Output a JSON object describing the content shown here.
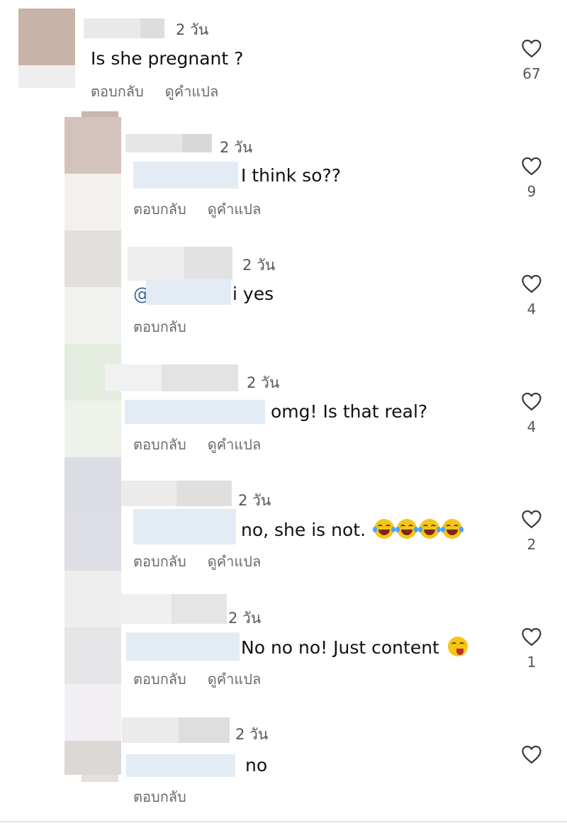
{
  "labels": {
    "reply": "ตอบกลับ",
    "translate": "ดูคำแปล"
  },
  "comments": [
    {
      "time": "2 วัน",
      "text": "Is she pregnant ?",
      "likes": "67"
    },
    {
      "time": "2 วัน",
      "text": "I think so??",
      "likes": "9"
    },
    {
      "time": "2 วัน",
      "mention_prefix": "@",
      "text": "i yes",
      "likes": "4"
    },
    {
      "time": "2 วัน",
      "text": "omg! Is that real?",
      "likes": "4"
    },
    {
      "time": "2 วัน",
      "text": "no, she is not.",
      "likes": "2"
    },
    {
      "time": "2 วัน",
      "text": "No no no! Just content",
      "likes": "1"
    },
    {
      "time": "2 วัน",
      "text": "no",
      "likes": ""
    }
  ],
  "icons": {
    "like": "heart-outline-icon",
    "laugh": "face-with-tears-of-joy-icon",
    "tongue": "winking-face-with-tongue-icon"
  }
}
